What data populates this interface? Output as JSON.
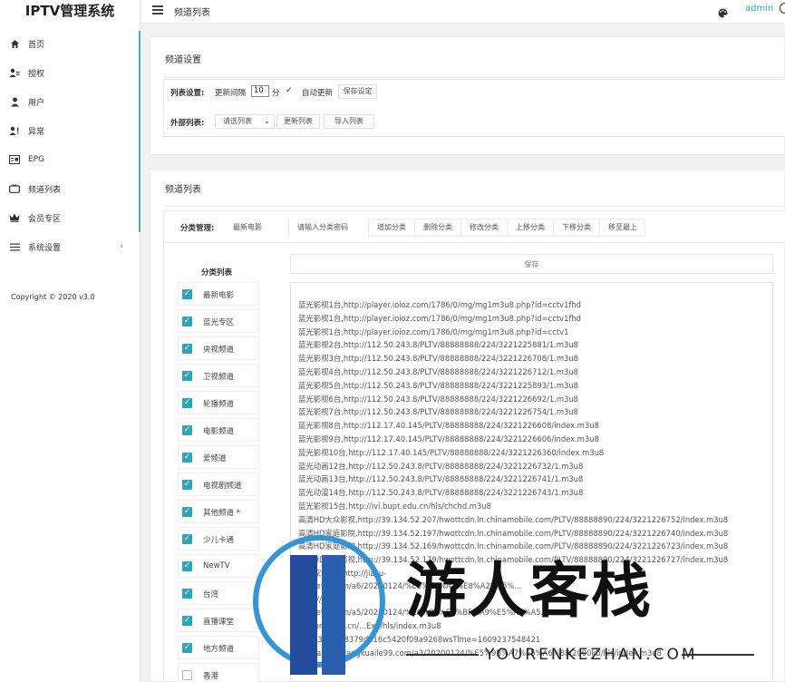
{
  "brand": "IPTV管理系统",
  "header": {
    "title": "频道列表",
    "user": "admin"
  },
  "sidebar": {
    "items": [
      {
        "label": "首页",
        "icon": "home-icon"
      },
      {
        "label": "授权",
        "icon": "user-key-icon"
      },
      {
        "label": "用户",
        "icon": "user-icon"
      },
      {
        "label": "异常",
        "icon": "user-alert-icon"
      },
      {
        "label": "EPG",
        "icon": "epg-icon"
      },
      {
        "label": "频道列表",
        "icon": "tv-icon"
      },
      {
        "label": "会员专区",
        "icon": "crown-icon"
      },
      {
        "label": "系统设置",
        "icon": "list-icon",
        "arrow": "›"
      }
    ],
    "copyright": "Copyright © 2020 v3.0"
  },
  "settings": {
    "title": "频道设置",
    "list_label": "列表设置:",
    "interval_label": "更新间隔",
    "interval_value": "10",
    "interval_unit": "分",
    "check_mark": "✓",
    "auto_update": "自动更新",
    "save_settings": "保存设定",
    "external_label": "外部列表:",
    "select_placeholder": "请选列表",
    "update_list": "更新列表",
    "import_list": "导入列表"
  },
  "channel_list": {
    "title": "频道列表",
    "category_manage_label": "分类管理:",
    "current_category": "最新电影",
    "category_input_placeholder": "请输入分类密码",
    "toolbar": [
      "增加分类",
      "删除分类",
      "修改分类",
      "上移分类",
      "下移分类",
      "移至最上"
    ],
    "save_label": "保存",
    "category_header": "分类列表",
    "categories": [
      {
        "label": "最新电影",
        "checked": true
      },
      {
        "label": "蓝光专区",
        "checked": true
      },
      {
        "label": "央视频道",
        "checked": true
      },
      {
        "label": "卫视频道",
        "checked": true
      },
      {
        "label": "轮播频道",
        "checked": true
      },
      {
        "label": "电影频道",
        "checked": true
      },
      {
        "label": "爱频道",
        "checked": true
      },
      {
        "label": "电视剧频道",
        "checked": true
      },
      {
        "label": "其他频道 *",
        "checked": true
      },
      {
        "label": "少儿卡通",
        "checked": true
      },
      {
        "label": "NewTV",
        "checked": true
      },
      {
        "label": "台湾",
        "checked": true
      },
      {
        "label": "直播课堂",
        "checked": true
      },
      {
        "label": "地方频道",
        "checked": true
      },
      {
        "label": "香港",
        "checked": false
      }
    ],
    "lines": [
      "蓝光影视1台,http://player.ioioz.com/1786/0/mg/mg1m3u8.php?id=cctv1fhd",
      "蓝光影视1台,http://player.ioioz.com/1786/0/mg/mg1m3u8.php?id=cctv1fhd",
      "蓝光影视1台,http://player.ioioz.com/1786/0/mg/mg1m3u8.php?id=cctv1",
      "蓝光影视2台,http://112.50.243.8/PLTV/88888888/224/3221225881/1.m3u8",
      "蓝光影视3台,http://112.50.243.8/PLTV/88888888/224/3221226708/1.m3u8",
      "蓝光影视4台,http://112.50.243.8/PLTV/88888888/224/3221226712/1.m3u8",
      "蓝光影视5台,http://112.50.243.8/PLTV/88888888/224/3221225893/1.m3u8",
      "蓝光影视6台,http://112.50.243.8/PLTV/88888888/224/3221226692/1.m3u8",
      "蓝光影视7台,http://112.50.243.8/PLTV/88888888/224/3221226754/1.m3u8",
      "蓝光影视8台,http://112.17.40.145/PLTV/88888888/224/3221226608/index.m3u8",
      "蓝光影视9台,http://112.17.40.145/PLTV/88888888/224/3221226606/index.m3u8",
      "蓝光影视10台,http://112.17.40.145/PLTV/88888888/224/3221226360/index.m3u8",
      "蓝光动画12台,http://112.50.243.8/PLTV/88888888/224/3221226732/1.m3u8",
      "蓝光动画13台,http://112.50.243.8/PLTV/88888888/224/3221226741/1.m3u8",
      "蓝光动漫14台,http://112.50.243.8/PLTV/88888888/224/3221226743/1.m3u8",
      "蓝光影视15台,http://ivi.bupt.edu.cn/hls/chchd.m3u8",
      "高清HD大众影视,http://39.134.52.207/hwottcdn.ln.chinamobile.com/PLTV/88888890/224/3221226752/index.m3u8",
      "高清HD家庭影院,http://39.134.52.197/hwottcdn.ln.chinamobile.com/PLTV/88888890/224/3221226740/index.m3u8",
      "高清HD家庭影院,http://39.134.52.169/hwottcdn.ln.chinamobile.com/PLTV/88888890/224/3221226723/index.m3u8",
      "高清HD卡通影视,http://39.134.52.179/hwottcdn.ln.chinamobile.com/PLTV/88888890/224/3221226727/index.m3u8",
      "大赢家2020,http://jiasu-",
      "kuaile99.com/a6/20200124/%E5%9B%A7%E8%A2%E5%...",
      "http://jiasu",
      "kuaile99.com/a5/20200124/%E6%80%E5%BF%A9%E5%A5%A5...",
      "videong.gzff.cn/...Exy/hls/index.m3u8",
      "d4d6306...d8379d016c5420f09a9268wsTime=1609237548421",
      "iasu-a3.kankangkuaile99.com/a3/20200124/%E5%9B%A7%E5%A6%88/2000kb/hls/index.m3u8"
    ]
  },
  "watermark": {
    "text": "游人客栈",
    "sub": "YOURENKEZHAN.COM"
  }
}
